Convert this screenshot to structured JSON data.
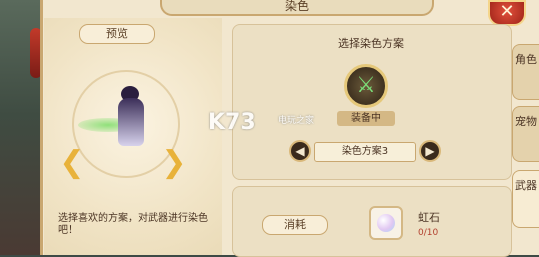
{
  "window": {
    "title": "染色",
    "close_label": "✕"
  },
  "preview": {
    "label": "预览",
    "description": "选择喜欢的方案，对武器进行染色吧！",
    "prev_arrow": "❮",
    "next_arrow": "❯"
  },
  "scheme": {
    "title": "选择染色方案",
    "equipped_label": "装备中",
    "selected": "染色方案3",
    "prev_label": "◀",
    "next_label": "▶"
  },
  "consume": {
    "label": "消耗",
    "item_name": "虹石",
    "item_count": "0/10"
  },
  "tabs": [
    {
      "label": "角色",
      "active": false
    },
    {
      "label": "宠物",
      "active": false
    },
    {
      "label": "武器",
      "active": true
    }
  ],
  "watermark": {
    "logo": "K73",
    "sub": "电玩之家"
  },
  "icons": {
    "close": "close-icon",
    "weapon": "sword-icon",
    "gem": "rainbow-gem-icon",
    "arrow_left": "arrow-left-icon",
    "arrow_right": "arrow-right-icon"
  },
  "colors": {
    "panel_bg": "#f2e7cf",
    "border": "#c9a770",
    "accent_red": "#b3412f",
    "text": "#4b3424"
  }
}
